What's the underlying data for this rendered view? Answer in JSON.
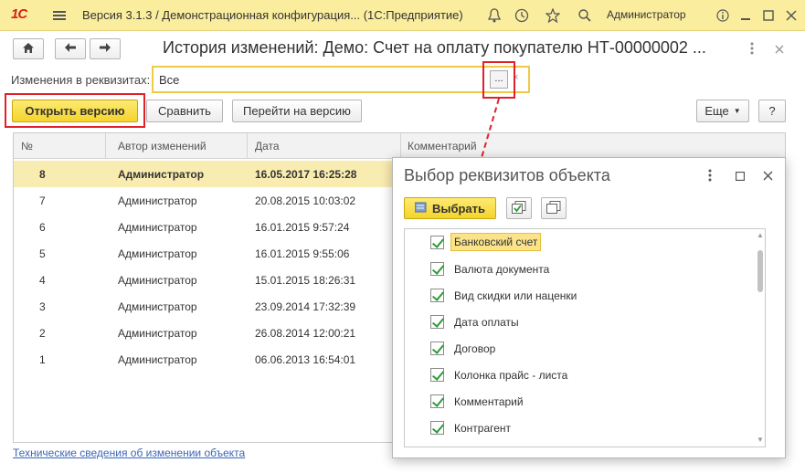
{
  "titlebar": {
    "logo": "1С",
    "title": "Версия 3.1.3 / Демонстрационная конфигурация...   (1С:Предприятие)",
    "user": "Администратор",
    "icons": [
      "menu-icon",
      "bell-icon",
      "history-icon",
      "star-icon",
      "search-icon",
      "info-icon",
      "minimize-icon",
      "maximize-icon",
      "close-icon"
    ]
  },
  "window": {
    "title": "История изменений: Демо: Счет на оплату покупателю НТ-00000002 ...",
    "attr_label": "Изменения в реквизитах:",
    "attr_value": "Все",
    "attr_dots": "...",
    "attr_clear": "×"
  },
  "toolbar": {
    "open_version": "Открыть версию",
    "compare": "Сравнить",
    "goto_version": "Перейти на версию",
    "more": "Еще",
    "help": "?"
  },
  "table": {
    "headers": [
      "№",
      "Автор изменений",
      "Дата",
      "Комментарий"
    ],
    "rows": [
      {
        "num": "8",
        "author": "Администратор",
        "date": "16.05.2017 16:25:28"
      },
      {
        "num": "7",
        "author": "Администратор",
        "date": "20.08.2015 10:03:02"
      },
      {
        "num": "6",
        "author": "Администратор",
        "date": "16.01.2015 9:57:24"
      },
      {
        "num": "5",
        "author": "Администратор",
        "date": "16.01.2015 9:55:06"
      },
      {
        "num": "4",
        "author": "Администратор",
        "date": "15.01.2015 18:26:31"
      },
      {
        "num": "3",
        "author": "Администратор",
        "date": "23.09.2014 17:32:39"
      },
      {
        "num": "2",
        "author": "Администратор",
        "date": "26.08.2014 12:00:21"
      },
      {
        "num": "1",
        "author": "Администратор",
        "date": "06.06.2013 16:54:01"
      }
    ]
  },
  "footer": {
    "link": "Технические сведения об изменении объекта"
  },
  "popup": {
    "title": "Выбор реквизитов объекта",
    "select": "Выбрать",
    "items": [
      "Банковский счет",
      "Валюта документа",
      "Вид скидки или наценки",
      "Дата оплаты",
      "Договор",
      "Колонка прайс - листа",
      "Комментарий",
      "Контрагент"
    ]
  },
  "colors": {
    "accent_yellow": "#f5d42b",
    "highlight_red": "#e0212a",
    "selected_row": "#f9ecb0",
    "titlebar": "#fbed9e",
    "link": "#3c66b8"
  }
}
